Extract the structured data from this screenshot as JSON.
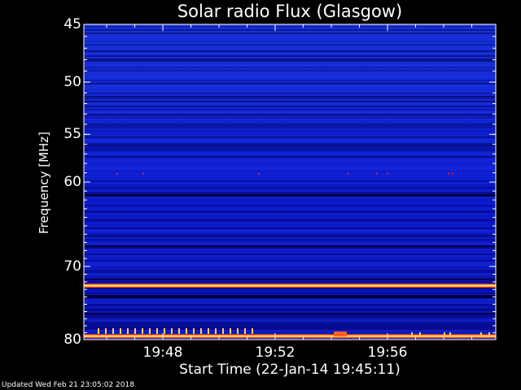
{
  "chart_data": {
    "type": "heatmap",
    "title": "Solar radio Flux (Glasgow)",
    "xlabel": "Start Time (22-Jan-14 19:45:11)",
    "ylabel": "Frequency [MHz]",
    "x_ticks": [
      "19:48",
      "19:52",
      "19:56"
    ],
    "y_ticks": [
      45,
      50,
      55,
      60,
      70,
      80
    ],
    "ylim": [
      80,
      45
    ],
    "y_scale": "log",
    "colors": {
      "background": "#0a17c9",
      "low": "#000040",
      "high": "#ffb040",
      "band": "#ff3000"
    },
    "features": [
      {
        "label": "intense emission band",
        "frequency": 72.5
      },
      {
        "label": "intense emission band",
        "frequency": 79.5
      }
    ]
  },
  "footer": {
    "updated": "Updated Wed Feb 21 23:05:02 2018"
  }
}
